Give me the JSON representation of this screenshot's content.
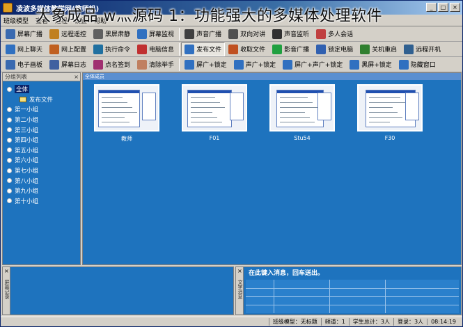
{
  "window": {
    "title": "凌波多媒体教学网(教师机)",
    "overlay_caption": "大象成品 w灬源码 1：功能强大的多媒体处理软件"
  },
  "menu": [
    "班级模型",
    "查看",
    "远程",
    "设置",
    "帮助"
  ],
  "toolbar": {
    "row1": [
      {
        "label": "屏幕广播",
        "icon": "screen-broadcast-icon",
        "color": "#3a6ab0"
      },
      {
        "label": "远程遥控",
        "icon": "remote-control-icon",
        "color": "#c08020"
      },
      {
        "label": "黑屏肃静",
        "icon": "black-screen-icon",
        "color": "#606060"
      },
      {
        "label": "屏幕监视",
        "icon": "screen-monitor-icon",
        "color": "#3070c0"
      },
      {
        "label": "声音广播",
        "icon": "microphone-icon",
        "color": "#404040"
      },
      {
        "label": "双向对讲",
        "icon": "phone-icon",
        "color": "#505050"
      },
      {
        "label": "声音监听",
        "icon": "headphone-icon",
        "color": "#303030"
      },
      {
        "label": "多人会话",
        "icon": "users-icon",
        "color": "#c04040"
      }
    ],
    "row2": [
      {
        "label": "网上聊天",
        "icon": "chat-icon",
        "color": "#3070c0"
      },
      {
        "label": "网上配置",
        "icon": "config-icon",
        "color": "#c06020"
      },
      {
        "label": "执行命令",
        "icon": "run-command-icon",
        "color": "#2070a0"
      },
      {
        "label": "电脑信息",
        "icon": "computer-info-icon",
        "color": "#c03030"
      },
      {
        "label": "发布文件",
        "icon": "publish-file-icon",
        "color": "#3070c0"
      },
      {
        "label": "收取文件",
        "icon": "receive-file-icon",
        "color": "#c05020"
      },
      {
        "label": "影音广播",
        "icon": "video-broadcast-icon",
        "color": "#20a040"
      },
      {
        "label": "锁定电脑",
        "icon": "lock-computer-icon",
        "color": "#3060b0"
      },
      {
        "label": "关机重启",
        "icon": "shutdown-icon",
        "color": "#308030"
      },
      {
        "label": "远程开机",
        "icon": "power-on-icon",
        "color": "#306090"
      }
    ],
    "row3": [
      {
        "label": "电子画板",
        "icon": "whiteboard-icon",
        "color": "#3a6ab0"
      },
      {
        "label": "屏幕日志",
        "icon": "screen-log-icon",
        "color": "#4060a0"
      },
      {
        "label": "点名签到",
        "icon": "roll-call-icon",
        "color": "#a03070"
      },
      {
        "label": "清除举手",
        "icon": "hand-icon",
        "color": "#c08060"
      },
      {
        "label": "屏广+锁定",
        "icon": "broadcast-lock-icon",
        "color": "#3070c0"
      },
      {
        "label": "声广+锁定",
        "icon": "sound-lock-icon",
        "color": "#3070c0"
      },
      {
        "label": "屏广+声广+锁定",
        "icon": "all-broadcast-lock-icon",
        "color": "#3070c0"
      },
      {
        "label": "黑屏+锁定",
        "icon": "black-lock-icon",
        "color": "#3070c0"
      },
      {
        "label": "隐藏窗口",
        "icon": "hide-window-icon",
        "color": "#3070c0"
      }
    ]
  },
  "groups_panel": {
    "title": "分组列表",
    "all_label": "全体",
    "child_label": "发布文件",
    "groups": [
      "第一小组",
      "第二小组",
      "第三小组",
      "第四小组",
      "第五小组",
      "第六小组",
      "第七小组",
      "第八小组",
      "第九小组",
      "第十小组"
    ]
  },
  "main_panel": {
    "title": "全体成员",
    "students": [
      {
        "name": "教师"
      },
      {
        "name": "F01"
      },
      {
        "name": "Stu54"
      },
      {
        "name": "F30"
      }
    ]
  },
  "bottom_left": {
    "side_label": "屏幕记录"
  },
  "bottom_right": {
    "side_label": "文字消息",
    "input_hint": "在此键入消息，回车送出。"
  },
  "statusbar": {
    "model": "班级模型：无标题",
    "channel": "频道：1",
    "student_total": "学生总计：3人",
    "login": "登录：3人",
    "time": "08:14:19"
  }
}
